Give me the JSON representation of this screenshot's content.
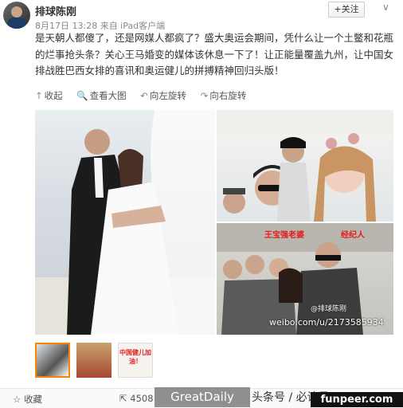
{
  "post": {
    "username": "排球陈刚",
    "meta": "8月17日 13:28 来自 iPad客户端",
    "follow_label": "+关注",
    "menu_glyph": "∨",
    "text": "是天朝人都傻了，还是网媒人都疯了？盛大奥运会期间，凭什么让一个土鳖和花瓶的烂事抢头条？关心王马婚变的媒体该休息一下了！让正能量覆盖九州，让中国女排战胜巴西女排的喜讯和奥运健儿的拼搏精神回归头版！"
  },
  "toolbar": [
    {
      "icon": "collapse-icon",
      "glyph": "↑",
      "label": "收起"
    },
    {
      "icon": "zoom-icon",
      "glyph": "🔍",
      "label": "查看大图"
    },
    {
      "icon": "rotate-left-icon",
      "glyph": "↶",
      "label": "向左旋转"
    },
    {
      "icon": "rotate-right-icon",
      "glyph": "↷",
      "label": "向右旋转"
    }
  ],
  "photo3": {
    "label_left": "王宝强老婆",
    "label_right": "经纪人",
    "watermark": "weibo.com/u/2173585934",
    "account_tag": "@排球陈刚"
  },
  "thumbnail3": {
    "text": "中国健儿加油！"
  },
  "bottom": {
    "favorite": "收藏",
    "repost_count": "4508"
  },
  "watermarks": {
    "greatdaily": "GreatDaily",
    "toutiao": "头条号 / 必读号",
    "funpeer": "funpeer.com"
  }
}
